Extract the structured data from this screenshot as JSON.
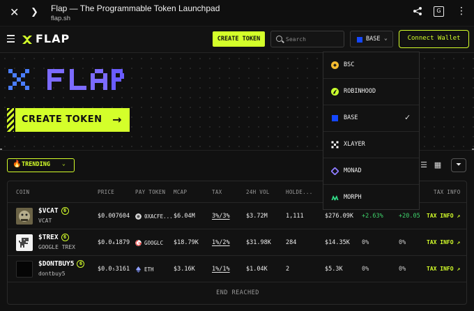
{
  "browser": {
    "title": "Flap — The Programmable Token Launchpad",
    "url": "flap.sh"
  },
  "header": {
    "logo_text": "FLAP",
    "create_token_label": "CREATE TOKEN",
    "search_placeholder": "Search",
    "chain_label": "BASE",
    "connect_label": "Connect Wallet"
  },
  "hero": {
    "logo_text": "FLAP",
    "create_token_label": "CREATE TOKEN"
  },
  "toolbar": {
    "sort_label": "TRENDING"
  },
  "chain_dropdown": {
    "items": [
      {
        "label": "BSC",
        "color": "#f3ba2f",
        "selected": false
      },
      {
        "label": "ROBINHOOD",
        "color": "#c8ff2e",
        "selected": false
      },
      {
        "label": "BASE",
        "color": "#1447ff",
        "selected": true
      },
      {
        "label": "XLAYER",
        "color": "#ffffff",
        "selected": false
      },
      {
        "label": "MONAD",
        "color": "#8e7cff",
        "selected": false
      },
      {
        "label": "MORPH",
        "color": "#31e08a",
        "selected": false
      }
    ]
  },
  "table": {
    "columns": [
      "COIN",
      "PRICE",
      "PAY TOKEN",
      "MCAP",
      "TAX",
      "24H VOL",
      "HOLDE...",
      "TAX INFO"
    ],
    "rows": [
      {
        "ticker": "$VCAT",
        "badge": "6",
        "name": "VCAT",
        "price": "$0.007604",
        "pay_token": "0XACFE...",
        "mcap": "$6.04M",
        "tax": "3%/3%",
        "vol": "$3.72M",
        "holders": "1,111",
        "liquidity": "$276.09K",
        "change1": "+2.63%",
        "change2": "+20.05",
        "tax_info": "TAX INFO ↗"
      },
      {
        "ticker": "$TREX",
        "badge": "6",
        "name": "GOOGLE TREX",
        "price": "$0.0₄1879",
        "pay_token": "GOOGLC",
        "mcap": "$18.79K",
        "tax": "1%/2%",
        "vol": "$31.98K",
        "holders": "284",
        "liquidity": "$14.35K",
        "change1": "0%",
        "change2": "0%",
        "tax_info": "TAX INFO ↗"
      },
      {
        "ticker": "$DONTBUY5",
        "badge": "6",
        "name": "dontbuy5",
        "price": "$0.0₅3161",
        "pay_token": "ETH",
        "mcap": "$3.16K",
        "tax": "1%/1%",
        "vol": "$1.04K",
        "holders": "2",
        "liquidity": "$5.3K",
        "change1": "0%",
        "change2": "0%",
        "tax_info": "TAX INFO ↗"
      }
    ],
    "end_text": "END REACHED"
  },
  "colors": {
    "accent": "#d4ff2a",
    "background": "#111111",
    "positive": "#3ed26b",
    "hero_logo": "#7c6bff"
  }
}
